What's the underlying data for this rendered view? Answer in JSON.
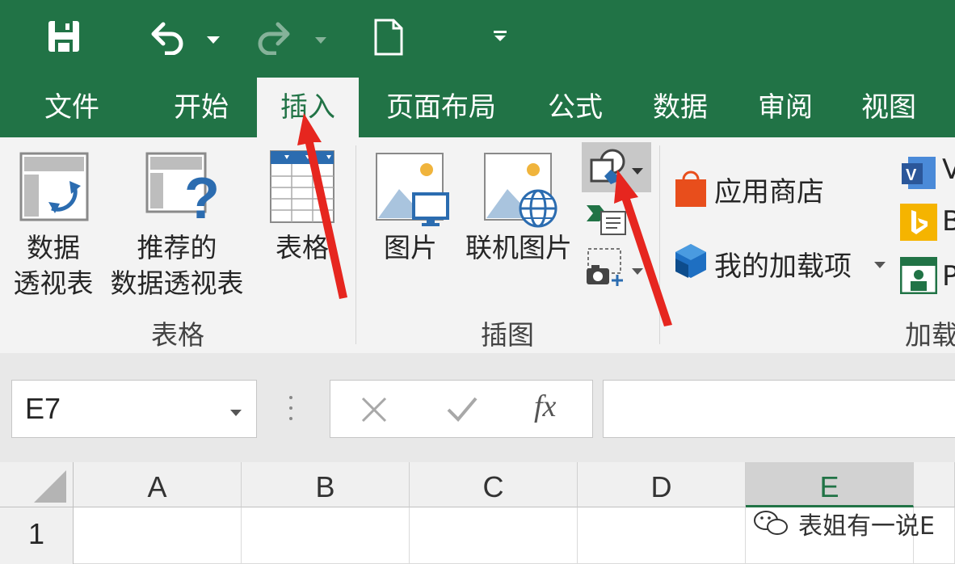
{
  "tabs": [
    {
      "label": "文件"
    },
    {
      "label": "开始"
    },
    {
      "label": "插入"
    },
    {
      "label": "页面布局"
    },
    {
      "label": "公式"
    },
    {
      "label": "数据"
    },
    {
      "label": "审阅"
    },
    {
      "label": "视图"
    }
  ],
  "ribbon": {
    "pivot_table": {
      "line1": "数据",
      "line2": "透视表"
    },
    "recommended_pivot": {
      "line1": "推荐的",
      "line2": "数据透视表"
    },
    "table": {
      "label": "表格"
    },
    "group_tables": "表格",
    "picture": {
      "label": "图片"
    },
    "online_picture": {
      "label": "联机图片"
    },
    "group_illustrations": "插图",
    "store": {
      "label": "应用商店"
    },
    "my_addins": {
      "label": "我的加载项"
    },
    "group_addins": "加载",
    "partial_v": "V",
    "partial_b": "B",
    "partial_p": "P"
  },
  "formula_bar": {
    "name_box": "E7",
    "fx": "fx",
    "value": ""
  },
  "grid": {
    "columns": [
      "A",
      "B",
      "C",
      "D",
      "E"
    ],
    "selected_column": "E",
    "rows": [
      "1"
    ]
  },
  "watermark": "表姐有一说E",
  "colors": {
    "excel_green": "#217346",
    "annotation_red": "#e6261f"
  }
}
